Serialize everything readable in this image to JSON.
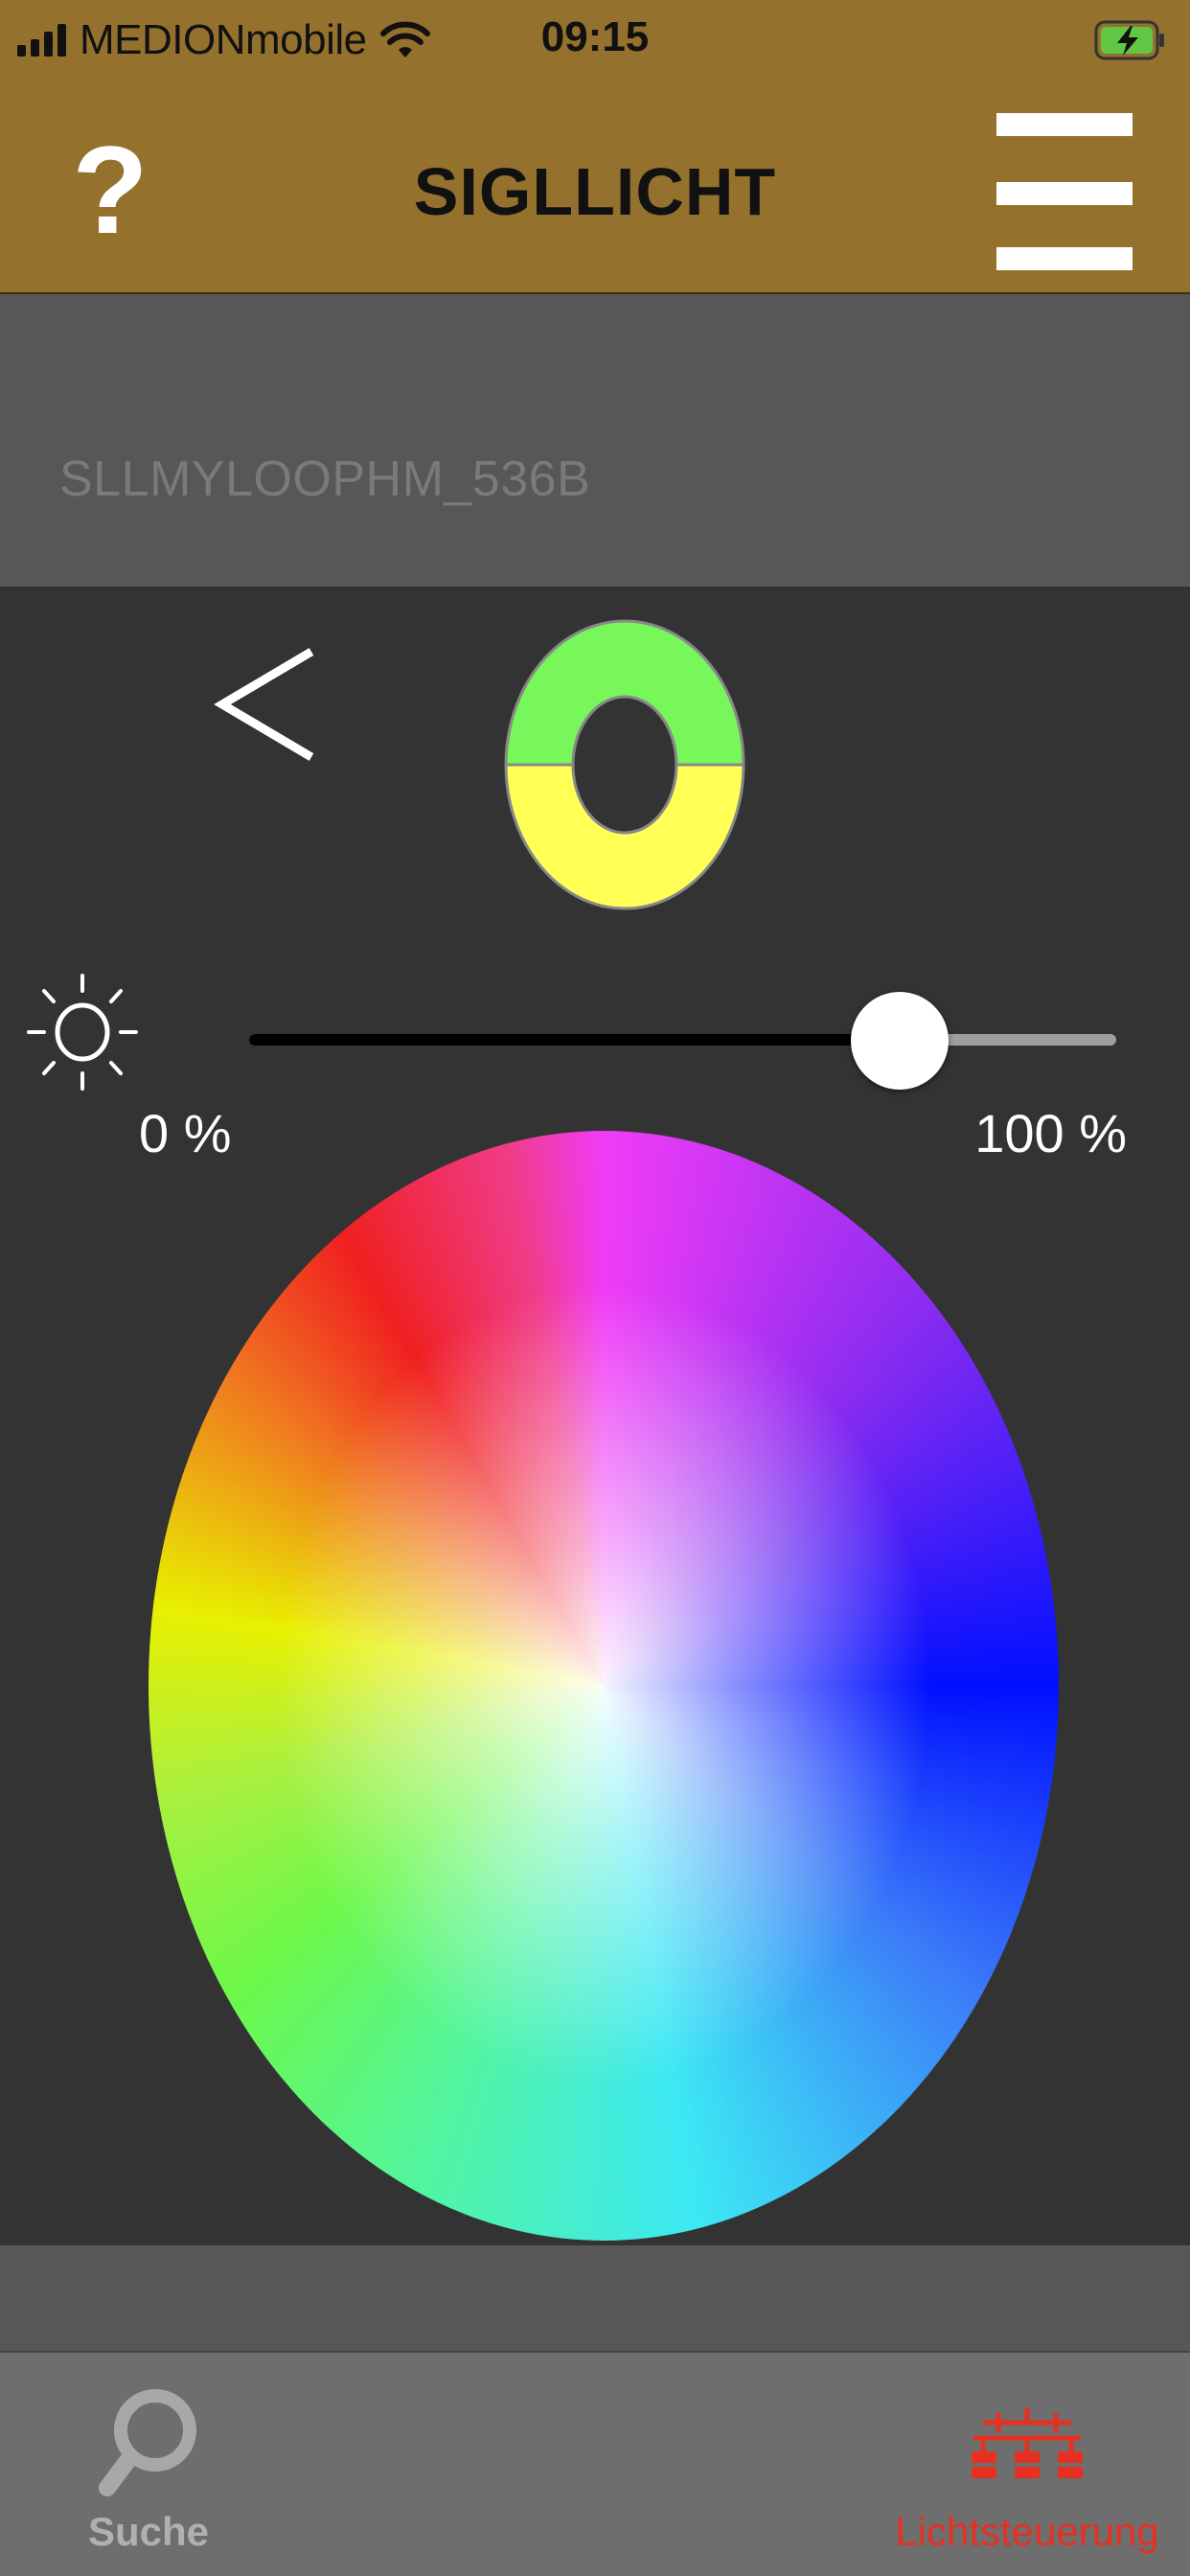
{
  "status_bar": {
    "carrier": "MEDIONmobile",
    "time": "09:15"
  },
  "nav": {
    "help_label": "?",
    "title": "SIGLLICHT"
  },
  "device": {
    "name": "SLLMYLOOPHM_536B"
  },
  "mode_indicator": {
    "top_color": "#77f75a",
    "bottom_color": "#ffff55"
  },
  "brightness": {
    "min_label": "0 %",
    "max_label": "100 %",
    "level_fraction": 0.75
  },
  "tab_bar": {
    "tabs": [
      {
        "label": "Suche",
        "icon": "search-icon",
        "active": false
      },
      {
        "label": "Lichtsteuerung",
        "icon": "network-icon",
        "active": true
      }
    ]
  },
  "colors": {
    "header": "#95712e",
    "accent_active": "#e53022"
  }
}
